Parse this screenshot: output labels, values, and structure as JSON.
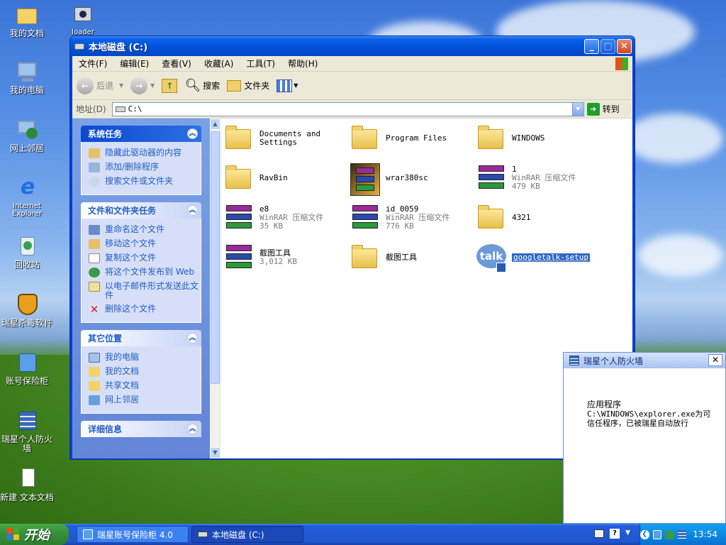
{
  "desktop": {
    "icons": [
      {
        "label": "我的文档"
      },
      {
        "label": "loader"
      },
      {
        "label": "我的电脑"
      },
      {
        "label": "网上邻居"
      },
      {
        "label": "Internet Explorer"
      },
      {
        "label": "回收站"
      },
      {
        "label": "瑞星杀毒软件"
      },
      {
        "label": "账号保险柜"
      },
      {
        "label": "瑞星个人防火墙"
      },
      {
        "label": "新建 文本文档"
      }
    ]
  },
  "window": {
    "title": "本地磁盘 (C:)",
    "menu": [
      "文件(F)",
      "编辑(E)",
      "查看(V)",
      "收藏(A)",
      "工具(T)",
      "帮助(H)"
    ],
    "toolbar": {
      "back": "后退",
      "search": "搜索",
      "folders": "文件夹"
    },
    "address": {
      "label": "地址(D)",
      "value": "C:\\",
      "go": "转到"
    },
    "tasks": {
      "system": {
        "title": "系统任务",
        "items": [
          "隐藏此驱动器的内容",
          "添加/删除程序",
          "搜索文件或文件夹"
        ]
      },
      "file": {
        "title": "文件和文件夹任务",
        "items": [
          "重命名这个文件",
          "移动这个文件",
          "复制这个文件",
          "将这个文件发布到 Web",
          "以电子邮件形式发送此文件",
          "删除这个文件"
        ]
      },
      "other": {
        "title": "其它位置",
        "items": [
          "我的电脑",
          "我的文档",
          "共享文档",
          "网上邻居"
        ]
      },
      "details": {
        "title": "详细信息"
      }
    },
    "files": [
      {
        "name": "Documents and Settings",
        "type": "",
        "size": ""
      },
      {
        "name": "Program Files",
        "type": "",
        "size": ""
      },
      {
        "name": "WINDOWS",
        "type": "",
        "size": ""
      },
      {
        "name": "RavBin",
        "type": "",
        "size": ""
      },
      {
        "name": "wrar380sc",
        "type": "",
        "size": ""
      },
      {
        "name": "1",
        "type": "WinRAR 压缩文件",
        "size": "479 KB"
      },
      {
        "name": "e8",
        "type": "WinRAR 压缩文件",
        "size": "35 KB"
      },
      {
        "name": "id_0059",
        "type": "WinRAR 压缩文件",
        "size": "776 KB"
      },
      {
        "name": "4321",
        "type": "",
        "size": ""
      },
      {
        "name": "截图工具",
        "type": "",
        "size": "3,012 KB"
      },
      {
        "name": "截图工具",
        "type": "",
        "size": ""
      },
      {
        "name": "googletalk-setup",
        "type": "",
        "size": ""
      }
    ]
  },
  "firewall": {
    "title": "瑞星个人防火墙",
    "line1": "应用程序",
    "line2": "C:\\WINDOWS\\explorer.exe为可信任程序，已被瑞星自动放行"
  },
  "taskbar": {
    "start": "开始",
    "tasks": [
      "瑞星账号保险柜 4.0",
      "本地磁盘 (C:)"
    ],
    "clock": "13:54"
  },
  "colors": {
    "accent": "#0a5fe8",
    "link": "#215dc6"
  }
}
